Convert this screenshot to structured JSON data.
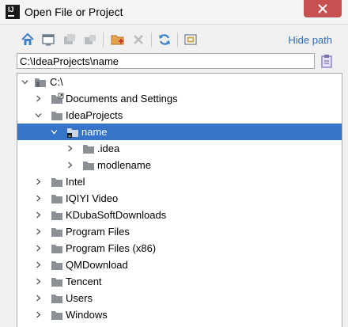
{
  "window": {
    "title": "Open File or Project"
  },
  "toolbar": {
    "icons": [
      "home-icon",
      "desktop-icon",
      "project-icon",
      "module-icon",
      "new-folder-icon",
      "delete-icon",
      "refresh-icon",
      "show-hidden-icon"
    ],
    "hide_path_label": "Hide path"
  },
  "path": {
    "value": "C:\\IdeaProjects\\name"
  },
  "tree": {
    "rows": [
      {
        "label": "C:\\",
        "indent": 0,
        "expanded": true,
        "kind": "drive"
      },
      {
        "label": "Documents and Settings",
        "indent": 1,
        "expanded": false,
        "kind": "link"
      },
      {
        "label": "IdeaProjects",
        "indent": 1,
        "expanded": true,
        "kind": "folder"
      },
      {
        "label": "name",
        "indent": 2,
        "expanded": true,
        "kind": "module",
        "selected": true
      },
      {
        "label": ".idea",
        "indent": 3,
        "expanded": false,
        "kind": "folder"
      },
      {
        "label": "modlename",
        "indent": 3,
        "expanded": false,
        "kind": "folder"
      },
      {
        "label": "Intel",
        "indent": 1,
        "expanded": false,
        "kind": "folder"
      },
      {
        "label": "IQIYI Video",
        "indent": 1,
        "expanded": false,
        "kind": "folder"
      },
      {
        "label": "KDubaSoftDownloads",
        "indent": 1,
        "expanded": false,
        "kind": "folder"
      },
      {
        "label": "Program Files",
        "indent": 1,
        "expanded": false,
        "kind": "folder"
      },
      {
        "label": "Program Files (x86)",
        "indent": 1,
        "expanded": false,
        "kind": "folder"
      },
      {
        "label": "QMDownload",
        "indent": 1,
        "expanded": false,
        "kind": "folder"
      },
      {
        "label": "Tencent",
        "indent": 1,
        "expanded": false,
        "kind": "folder"
      },
      {
        "label": "Users",
        "indent": 1,
        "expanded": false,
        "kind": "folder"
      },
      {
        "label": "Windows",
        "indent": 1,
        "expanded": false,
        "kind": "folder"
      }
    ]
  },
  "colors": {
    "selection": "#3574c8",
    "link": "#2e6fb7",
    "close": "#c75050",
    "folder": "#8a9095"
  }
}
